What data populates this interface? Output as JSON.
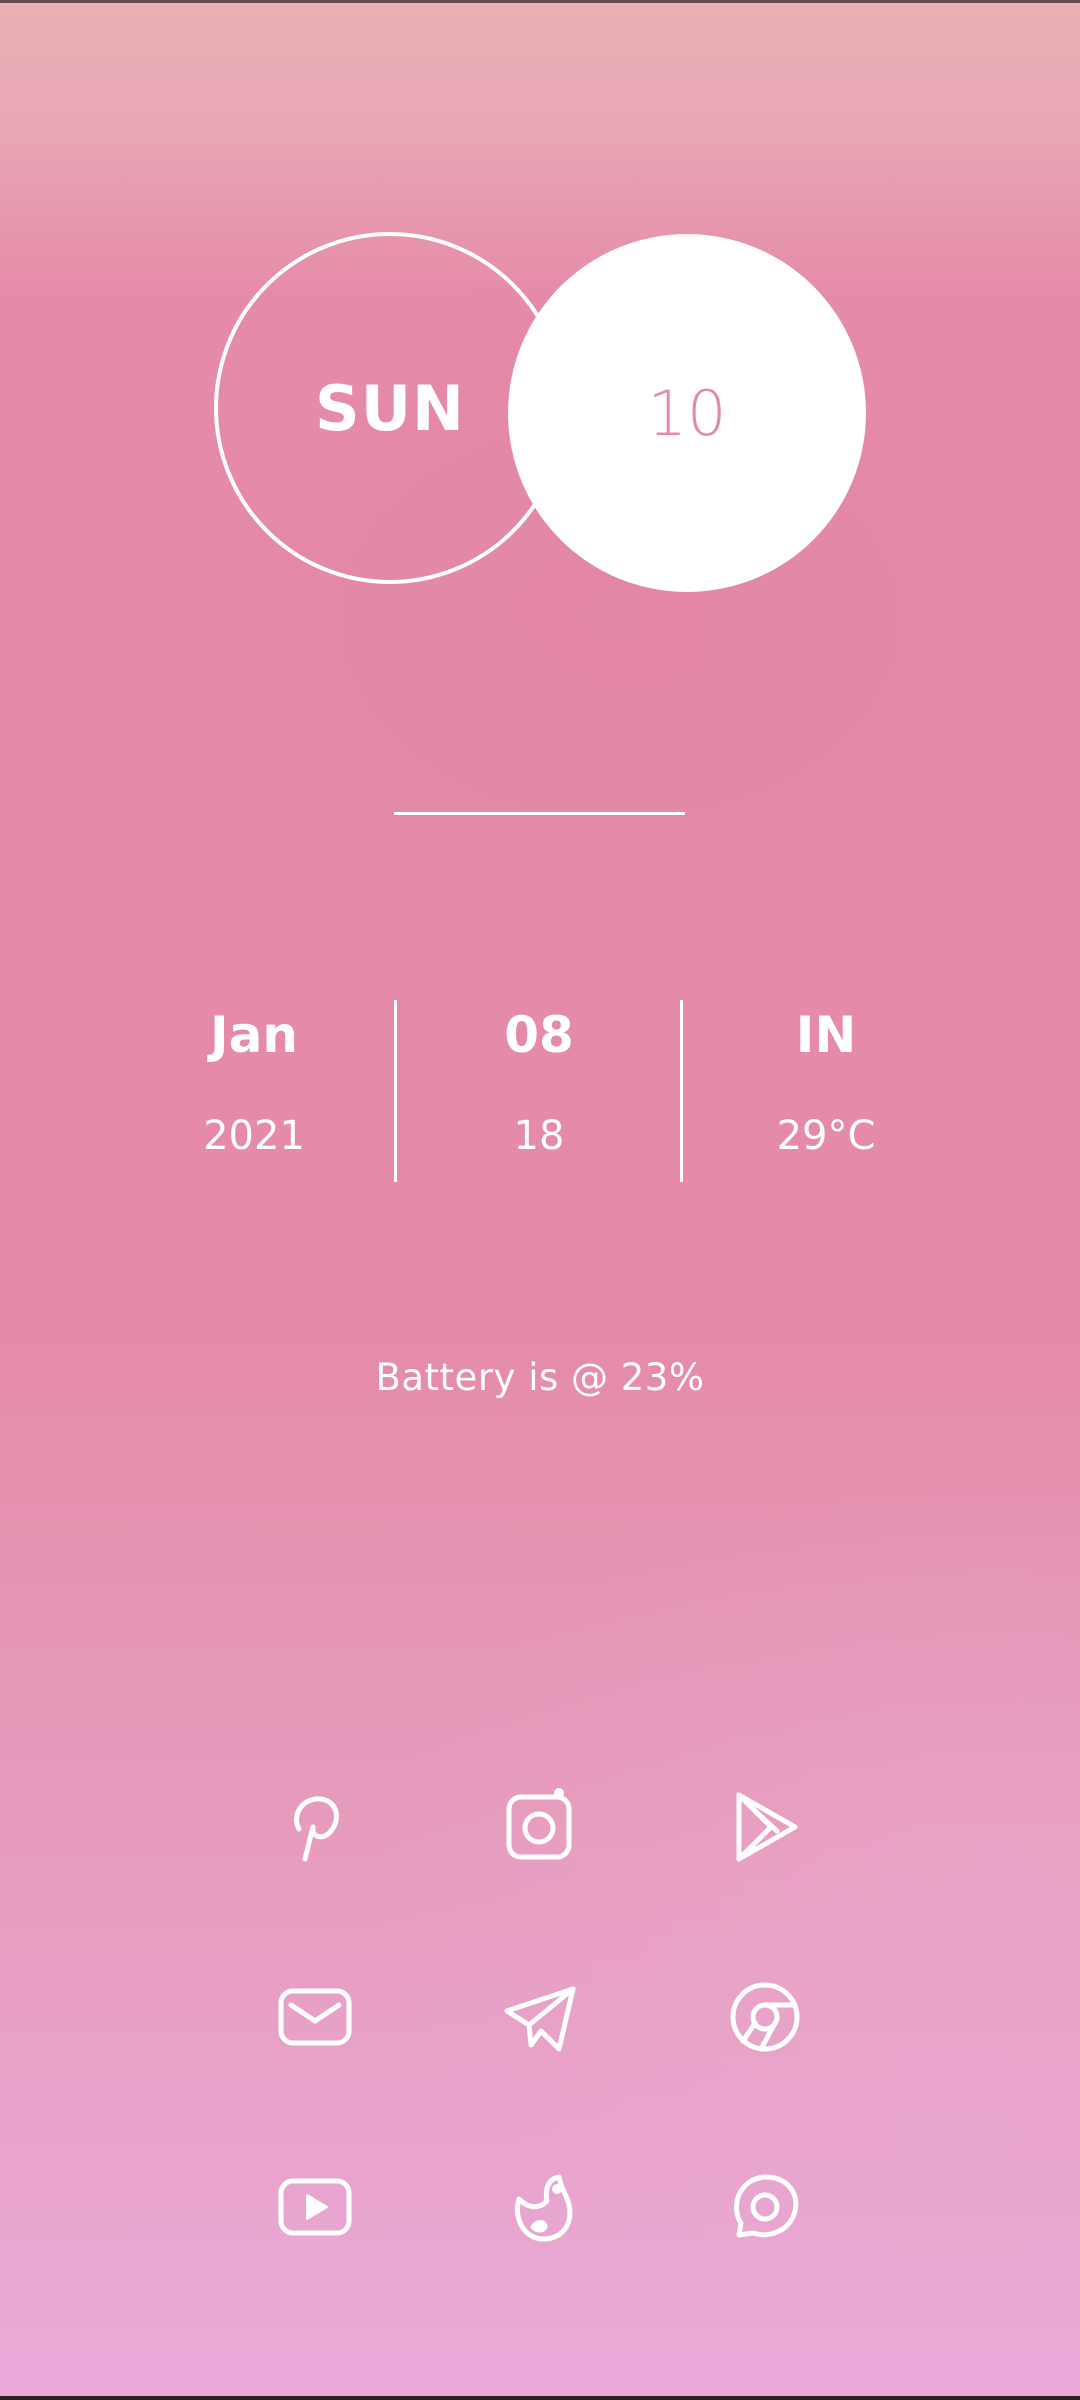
{
  "day": {
    "weekday": "SUN",
    "date": "10"
  },
  "info": {
    "month": "Jan",
    "year": "2021",
    "hour": "08",
    "minute": "18",
    "country": "IN",
    "temperature": "29°C"
  },
  "battery": {
    "text": "Battery is @ 23%"
  },
  "apps": [
    {
      "icon": "pinterest-icon"
    },
    {
      "icon": "instagram-icon"
    },
    {
      "icon": "play-store-icon"
    },
    {
      "icon": "mail-icon"
    },
    {
      "icon": "telegram-icon"
    },
    {
      "icon": "chrome-icon"
    },
    {
      "icon": "youtube-icon"
    },
    {
      "icon": "bird-icon"
    },
    {
      "icon": "chat-bubble-icon"
    }
  ],
  "colors": {
    "accent": "#e58aa8",
    "foreground": "#ffffff"
  }
}
